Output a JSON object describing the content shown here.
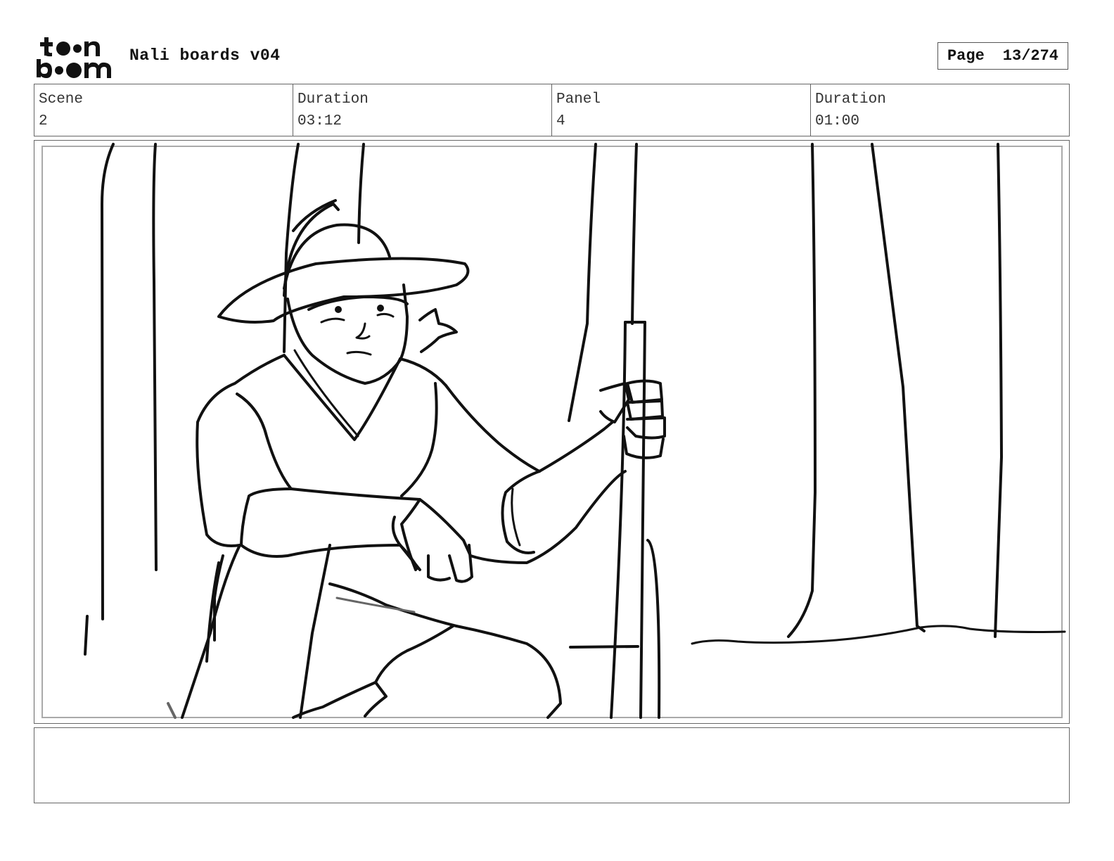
{
  "logo": {
    "text_top": "toon",
    "text_bottom": "boom",
    "icon": "toonboom-logo"
  },
  "document": {
    "title": "Nali boards v04"
  },
  "page_indicator": {
    "label": "Page",
    "value": "13/274"
  },
  "info": {
    "scene": {
      "label": "Scene",
      "value": "2"
    },
    "scene_duration": {
      "label": "Duration",
      "value": "03:12"
    },
    "panel": {
      "label": "Panel",
      "value": "4"
    },
    "panel_duration": {
      "label": "Duration",
      "value": "01:00"
    }
  },
  "panel_image": {
    "icon": "storyboard-sketch"
  },
  "notes": {
    "text": ""
  }
}
